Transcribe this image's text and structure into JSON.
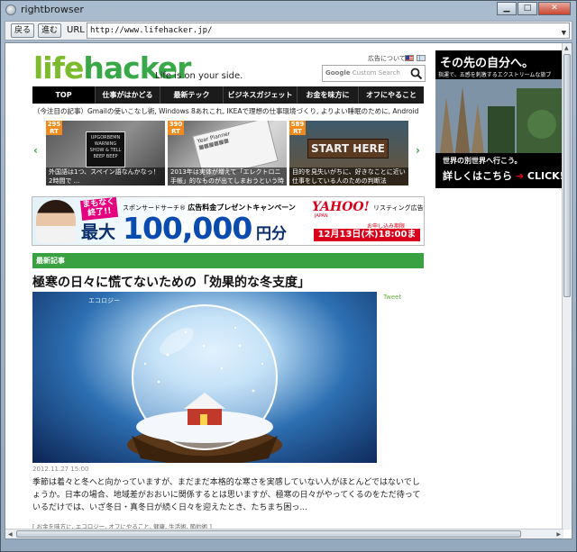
{
  "window": {
    "title": "rightbrowser",
    "minimize": "▁",
    "maximize": "□",
    "close": "✕"
  },
  "toolbar": {
    "back_label": "戻る",
    "forward_label": "進む",
    "url_label": "URL",
    "url_value": "http://www.lifehacker.jp/"
  },
  "site": {
    "logo_part1": "life",
    "logo_part2": "hacker",
    "tagline": "Life is on your side.",
    "ad_label": "広告について",
    "search_placeholder": "Custom Search",
    "search_brand": "Google"
  },
  "nav": [
    {
      "label": "TOP",
      "active": true
    },
    {
      "label": "仕事がはかどる"
    },
    {
      "label": "最新テック"
    },
    {
      "label": "ビジネスガジェット"
    },
    {
      "label": "お金を味方に"
    },
    {
      "label": "オフにやること"
    }
  ],
  "ticker": "（今注目の記事）Gmailの使いこなし術, Windows 8あれこれ, IKEAで理想の仕事環境づくり, よりよい睡眠のために, Android",
  "carousel": [
    {
      "count": "295",
      "caption": "外国語は1つ、スペイン語なんかなっ！2時間で ..."
    },
    {
      "count": "390",
      "caption": "2013年は実体が増えて「エレクトロニ手帳」的なものが出てしまおうという時代"
    },
    {
      "count": "589",
      "caption": "目的を見失いがちに、好きなことに近い仕事をしている人のための判断法"
    }
  ],
  "carousel_rt": "RT",
  "banner": {
    "sticker": "まもなく終了!!",
    "prefix": "最大",
    "sub_small": "スポンサードサーチ®",
    "sub_main": "広告料金プレゼントキャンペーン",
    "amount": "100,000",
    "unit": "円分",
    "yahoo": "YAHOO!",
    "yahoo_sub": "JAPAN",
    "listing": "リスティング広告",
    "apply": "お申し込み期限",
    "deadline": "12月13日(木)18:00まで"
  },
  "section_title": "最新記事",
  "article": {
    "title": "極寒の日々に慌てないための「効果的な冬支度」",
    "tweet": "Tweet",
    "image_label": "エコロジー",
    "date": "2012.11.27 15:00",
    "body": "季節は着々と冬へと向かっていますが、まだまだ本格的な寒さを実感していない人がほとんどではないでしょうか。日本の場合、地域差がおおいに関係するとは思いますが、極寒の日々がやってくるのをただ待っているだけでは、いざ冬日・真冬日が続く日々を迎えたとき、たちまち困っ...",
    "tags": "[ お金を味方に, エコロジー, オフにやること, 健康, 生活術, 節約術 ]"
  },
  "sidebar_ad": {
    "headline": "その先の自分へ。",
    "subline": "指運で、五感を刺激するエクストリームな旅ブ",
    "line1": "世界の別世界へ行こう。",
    "line2": "詳しくはこちら",
    "cta": "CLICK!"
  },
  "colors": {
    "brand_green": "#39a848",
    "nav_bg": "#1b1b1b",
    "rt_orange": "#f08a1c",
    "banner_blue": "#0a4bb0",
    "yahoo_red": "#d8001a"
  }
}
